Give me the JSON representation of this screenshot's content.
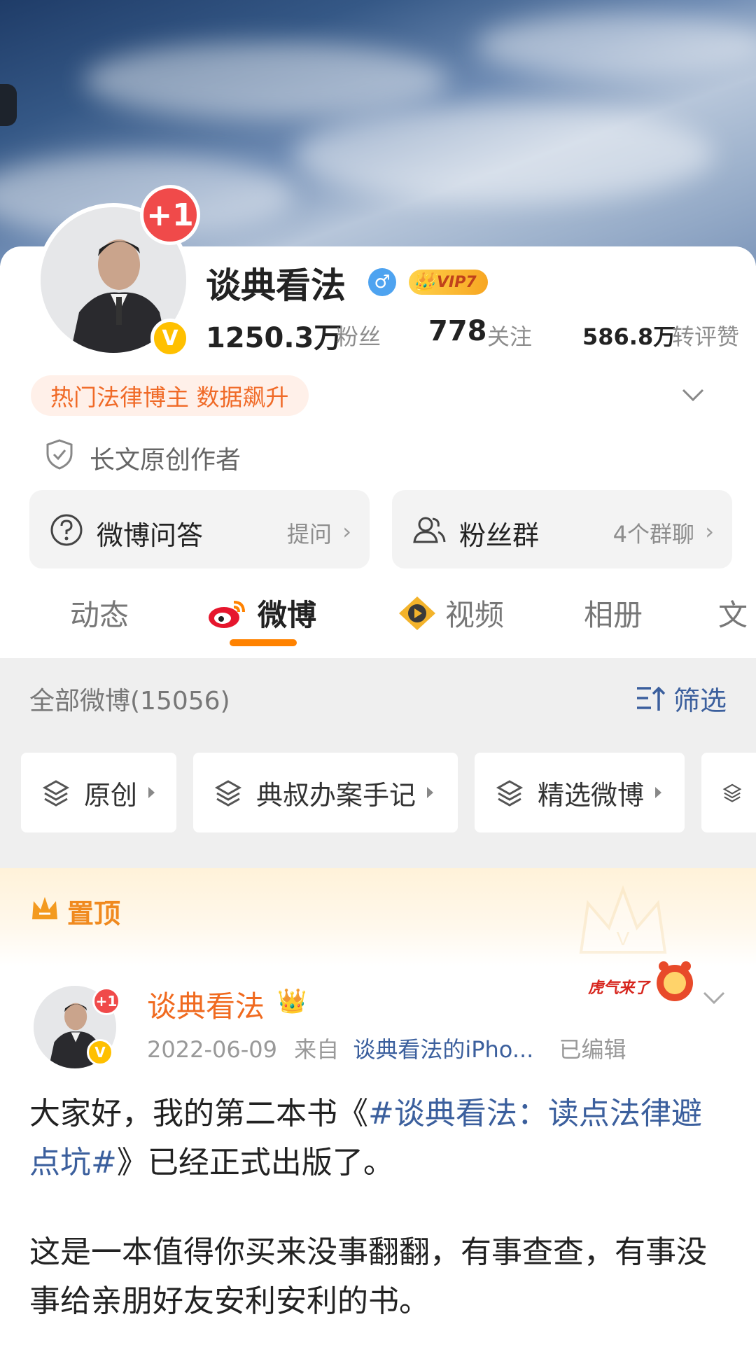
{
  "banner": {
    "description_icon": "sky-banner"
  },
  "profile": {
    "avatar_badge": "+1",
    "verified_badge": "V",
    "name": "谈典看法",
    "gender_icon": "♂",
    "vip_label": "VIP7",
    "followers_count": "1250.3万",
    "followers_label": "粉丝",
    "following_count": "778",
    "following_label": "关注",
    "interactions_count": "586.8万",
    "interactions_label": "转评赞",
    "hot_tag": "热门法律博主 数据飙升",
    "original_label": "长文原创作者"
  },
  "features": [
    {
      "title": "微博问答",
      "sub": "提问"
    },
    {
      "title": "粉丝群",
      "sub": "4个群聊"
    }
  ],
  "tabs": [
    {
      "label": "动态"
    },
    {
      "label": "微博"
    },
    {
      "label": "视频"
    },
    {
      "label": "相册"
    },
    {
      "label": "文"
    }
  ],
  "filter_bar": {
    "all_label": "全部微博(15056)",
    "filter_label": "筛选"
  },
  "chips": [
    {
      "label": "原创"
    },
    {
      "label": "典叔办案手记"
    },
    {
      "label": "精选微博"
    }
  ],
  "pinned": {
    "label": "置顶"
  },
  "post": {
    "avatar_badge": "+1",
    "verified_badge": "V",
    "author": "谈典看法",
    "date": "2022-06-09",
    "from_label": "来自",
    "source": "谈典看法的iPho...",
    "edited": "已编辑",
    "festival_text": "虎气来了",
    "para1_a": "大家好，我的第二本书《",
    "para1_tag": "#谈典看法：读点法律避点坑#",
    "para1_b": "》已经正式出版了。",
    "para2": "这是一本值得你买来没事翻翻，有事查查，有事没事给亲朋好友安利安利的书。"
  },
  "colors": {
    "accent_orange": "#ff8200",
    "link_blue": "#3b5f9d",
    "name_orange": "#f06a1f"
  }
}
